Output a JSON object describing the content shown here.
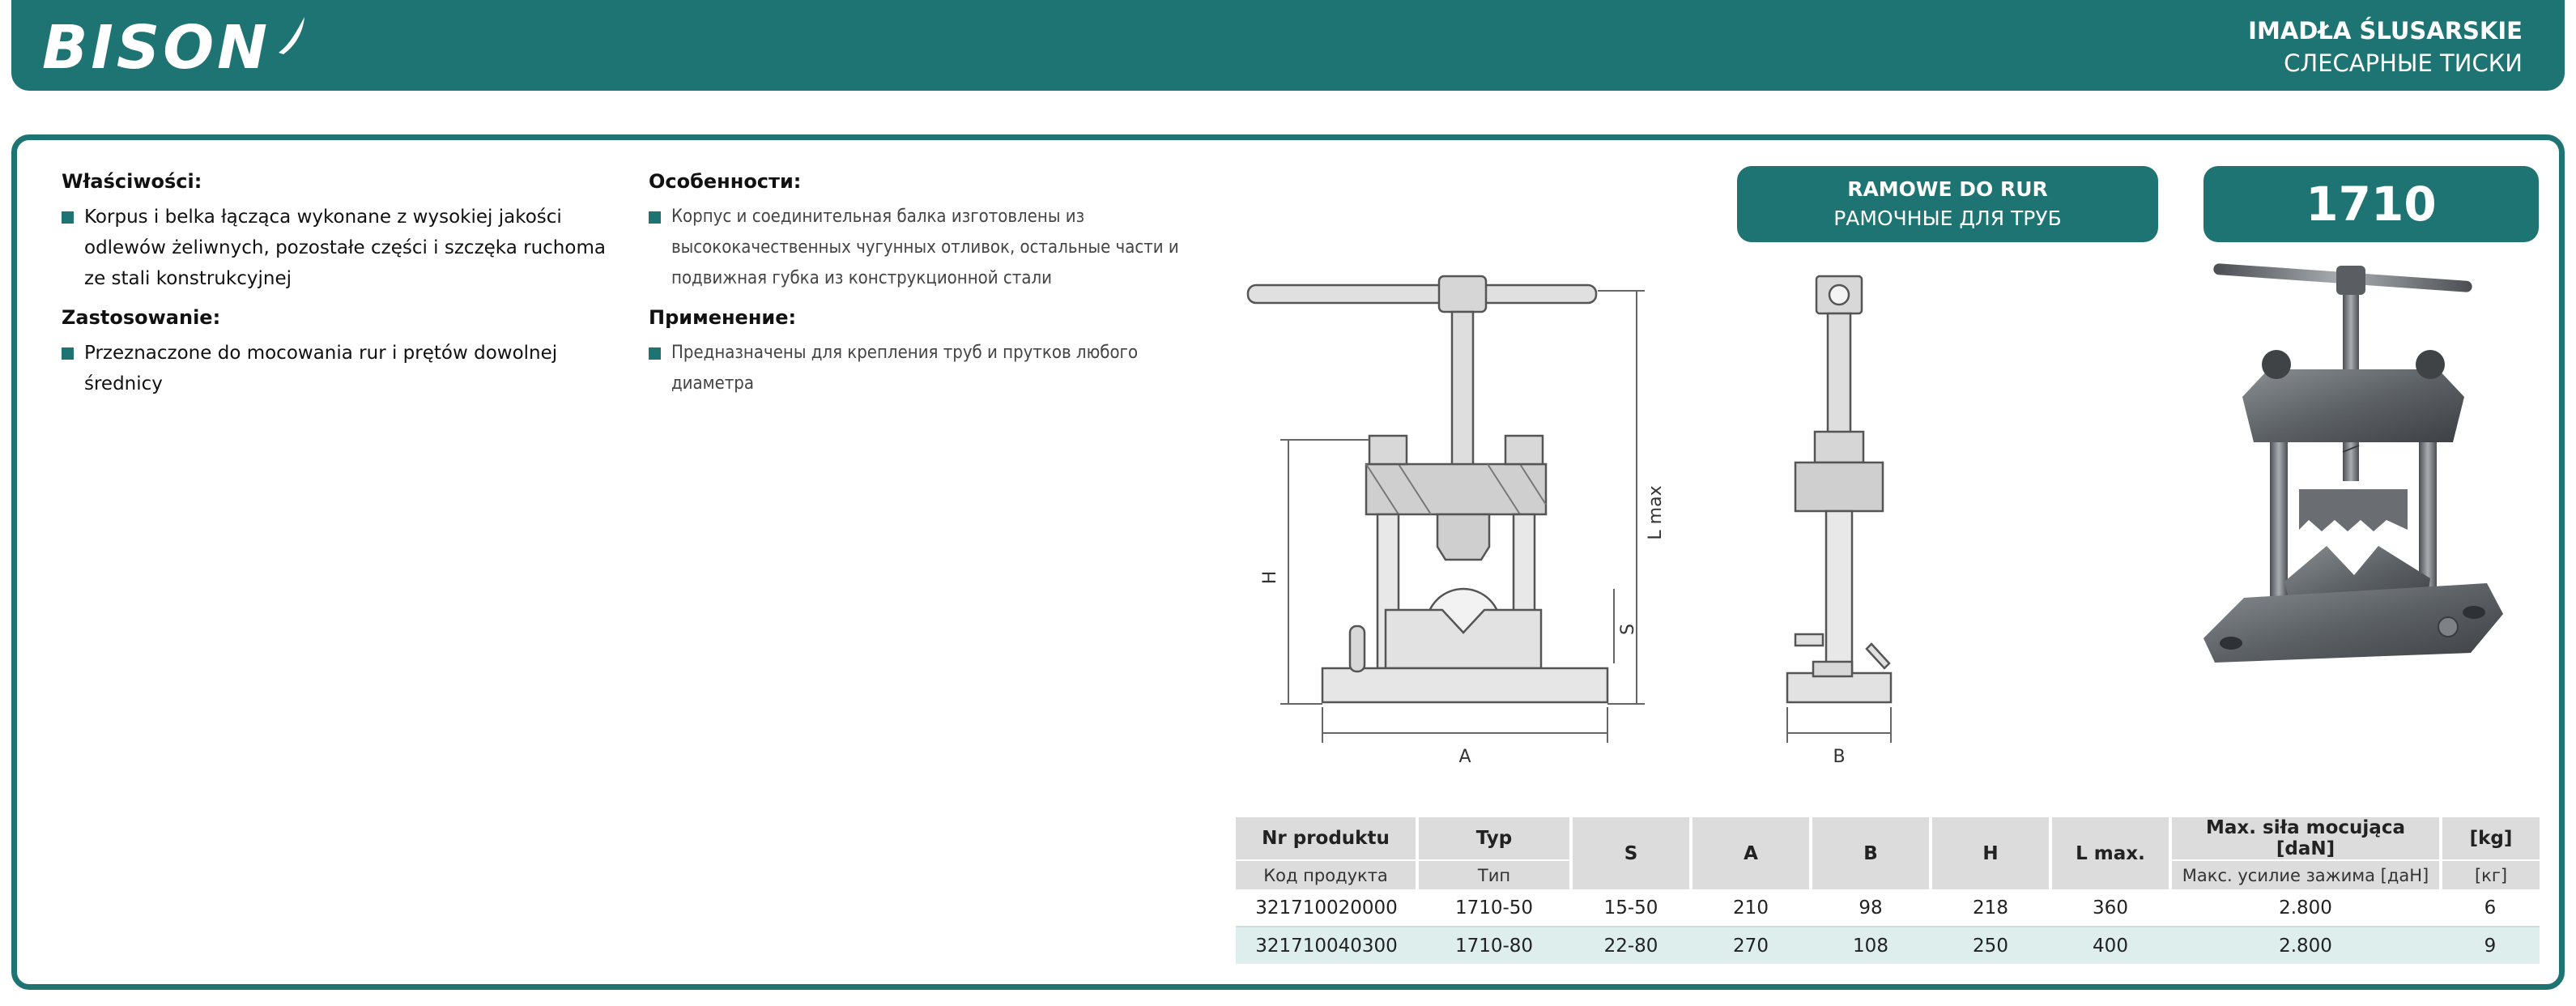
{
  "brand": {
    "name": "BISON"
  },
  "header": {
    "title_pl": "IMADŁA ŚLUSARSKIE",
    "title_ru": "СЛЕСАРНЫЕ ТИСКИ"
  },
  "description_pl": {
    "properties_heading": "Właściwości:",
    "properties": [
      "Korpus i belka łącząca wykonane z wysokiej jakości odlewów żeliwnych, pozostałe części i szczęka ruchoma ze stali konstrukcyjnej"
    ],
    "usage_heading": "Zastosowanie:",
    "usage": [
      "Przeznaczone do mocowania rur i prętów dowolnej średnicy"
    ]
  },
  "description_ru": {
    "properties_heading": "Особенности:",
    "properties": [
      "Корпус и соединительная балка изготовлены из высококачественных чугунных отливок, остальные части и подвижная губка из конструкционной стали"
    ],
    "usage_heading": "Применение:",
    "usage": [
      "Предназначены для крепления труб и прутков любого диаметра"
    ]
  },
  "type_badge": {
    "line1": "RAMOWE DO RUR",
    "line2": "РАМОЧНЫЕ ДЛЯ ТРУБ"
  },
  "model_badge": "1710",
  "drawing_labels": {
    "h": "H",
    "s": "S",
    "a": "A",
    "b": "B",
    "lmax": "L max"
  },
  "table": {
    "headers": {
      "product_no": "Nr produktu",
      "product_no_ru": "Код продукта",
      "type": "Typ",
      "type_ru": "Тип",
      "s": "S",
      "a": "A",
      "b": "B",
      "h": "H",
      "lmax": "L max.",
      "force": "Max. siła mocująca [daN]",
      "force_ru": "Макс. усилие зажима [даН]",
      "kg": "[kg]",
      "kg_ru": "[кг]"
    },
    "rows": [
      {
        "product_no": "321710020000",
        "type": "1710-50",
        "s": "15-50",
        "a": "210",
        "b": "98",
        "h": "218",
        "lmax": "360",
        "force": "2.800",
        "kg": "6"
      },
      {
        "product_no": "321710040300",
        "type": "1710-80",
        "s": "22-80",
        "a": "270",
        "b": "108",
        "h": "250",
        "lmax": "400",
        "force": "2.800",
        "kg": "9"
      }
    ]
  },
  "colors": {
    "brand_teal": "#1e7472",
    "table_header": "#dcdcdc",
    "table_alt_row": "#ddeeed"
  }
}
